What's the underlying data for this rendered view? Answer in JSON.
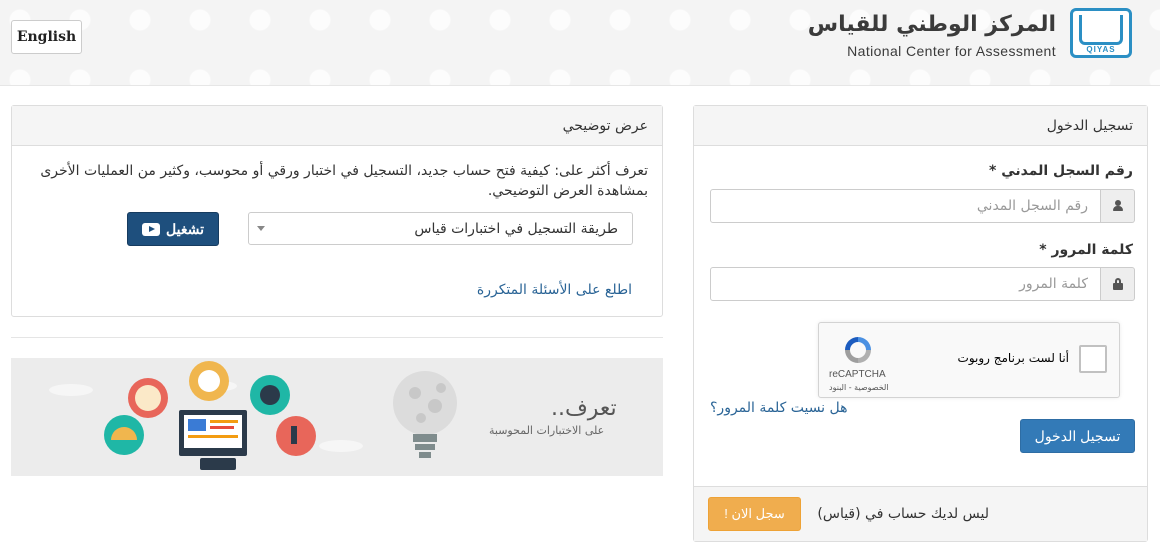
{
  "header": {
    "lang_button": "English",
    "logo_ar": "المركز الوطني للقياس",
    "logo_en": "National Center for Assessment",
    "logo_mark": "QIYAS"
  },
  "demo": {
    "title": "عرض توضيحي",
    "description": "تعرف أكثر على: كيفية فتح حساب جديد، التسجيل في اختبار ورقي أو محوسب، وكثير من العمليات الأخرى بمشاهدة العرض التوضيحي.",
    "select_value": "طريقة التسجيل في اختبارات قياس",
    "play_label": "تشغيل",
    "faq_link": "اطلع على الأسئلة المتكررة"
  },
  "banner": {
    "title": "تعرف..",
    "subtitle": "على الاختبارات المحوسبة"
  },
  "login": {
    "title": "تسجيل الدخول",
    "id_label": "رقم السجل المدني *",
    "id_placeholder": "رقم السجل المدني",
    "password_label": "كلمة المرور *",
    "password_placeholder": "كلمة المرور",
    "captcha_label": "أنا لست برنامج روبوت",
    "captcha_brand": "reCAPTCHA",
    "captcha_links": "الخصوصية - البنود",
    "forgot_link": "هل نسيت كلمة المرور؟",
    "submit_label": "تسجيل الدخول",
    "no_account_text": "ليس لديك حساب في (قياس)",
    "register_label": "سجل الان !"
  },
  "colors": {
    "primary": "#337ab7",
    "play_button": "#1e4f7d",
    "warning": "#f0ad4e",
    "link": "#2a6496"
  }
}
